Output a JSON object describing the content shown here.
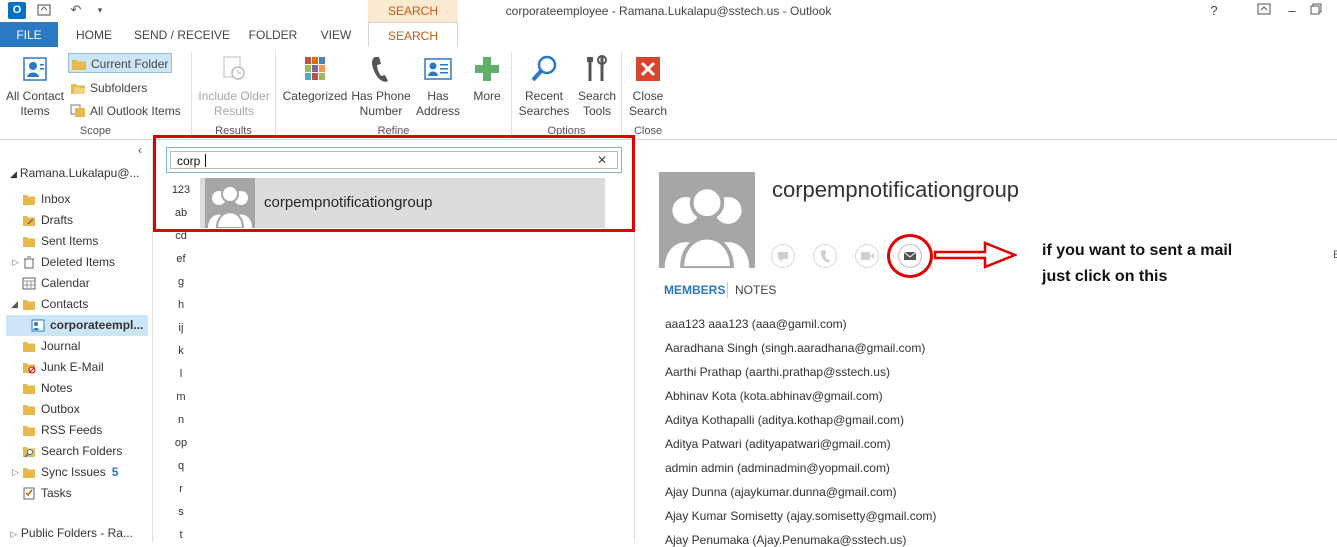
{
  "titlebar": {
    "title": "corporateemployee - Ramana.Lukalapu@sstech.us - Outlook",
    "contextual_tab": "SEARCH TOOLS",
    "help": "?"
  },
  "tabs": [
    {
      "label": "FILE"
    },
    {
      "label": "HOME"
    },
    {
      "label": "SEND / RECEIVE"
    },
    {
      "label": "FOLDER"
    },
    {
      "label": "VIEW"
    },
    {
      "label": "SEARCH"
    }
  ],
  "ribbon": {
    "scope": {
      "label": "Scope",
      "all_contact_items": "All Contact Items",
      "current_folder": "Current Folder",
      "subfolders": "Subfolders",
      "all_outlook_items": "All Outlook Items"
    },
    "results": {
      "label": "Results",
      "include_older": "Include Older Results"
    },
    "refine": {
      "label": "Refine",
      "categorized": "Categorized",
      "has_phone_number": "Has Phone Number",
      "has_address": "Has Address",
      "more": "More"
    },
    "options": {
      "label": "Options",
      "recent_searches": "Recent Searches",
      "search_tools": "Search Tools"
    },
    "close": {
      "label": "Close",
      "close_search": "Close Search"
    }
  },
  "nav": {
    "account": "Ramana.Lukalapu@...",
    "folders": [
      {
        "label": "Inbox"
      },
      {
        "label": "Drafts"
      },
      {
        "label": "Sent Items"
      },
      {
        "label": "Deleted Items"
      },
      {
        "label": "Calendar"
      },
      {
        "label": "Contacts"
      },
      {
        "label": "corporateempl..."
      },
      {
        "label": "Journal"
      },
      {
        "label": "Junk E-Mail"
      },
      {
        "label": "Notes"
      },
      {
        "label": "Outbox"
      },
      {
        "label": "RSS Feeds"
      },
      {
        "label": "Search Folders"
      },
      {
        "label": "Sync Issues",
        "count": "5"
      },
      {
        "label": "Tasks"
      }
    ],
    "public_folders": "Public Folders - Ra..."
  },
  "search": {
    "query": "corp",
    "clear_glyph": "✕"
  },
  "alphabet": [
    "123",
    "ab",
    "cd",
    "ef",
    "g",
    "h",
    "ij",
    "k",
    "l",
    "m",
    "n",
    "op",
    "q",
    "r",
    "s",
    "t"
  ],
  "results": [
    {
      "name": "corpempnotificationgroup"
    }
  ],
  "detail": {
    "name": "corpempnotificationgroup",
    "tab_members": "MEMBERS",
    "tab_notes": "NOTES",
    "annotation_line1": "if you want to sent a mail",
    "annotation_line2": "just click on this",
    "members": [
      "aaa123 aaa123 (aaa@gamil.com)",
      "Aaradhana Singh (singh.aaradhana@gmail.com)",
      "Aarthi Prathap (aarthi.prathap@sstech.us)",
      "Abhinav Kota (kota.abhinav@gmail.com)",
      "Aditya Kothapalli (aditya.kothap@gmail.com)",
      "Aditya Patwari (adityapatwari@gmail.com)",
      "admin admin (adminadmin@yopmail.com)",
      "Ajay Dunna (ajaykumar.dunna@gmail.com)",
      "Ajay Kumar Somisetty (ajay.somisetty@gmail.com)",
      "Ajay Penumaka (Ajay.Penumaka@sstech.us)"
    ]
  },
  "colors": {
    "accent": "#2b79c2",
    "search_tab": "#c55a11",
    "annotation_red": "#e00000"
  }
}
